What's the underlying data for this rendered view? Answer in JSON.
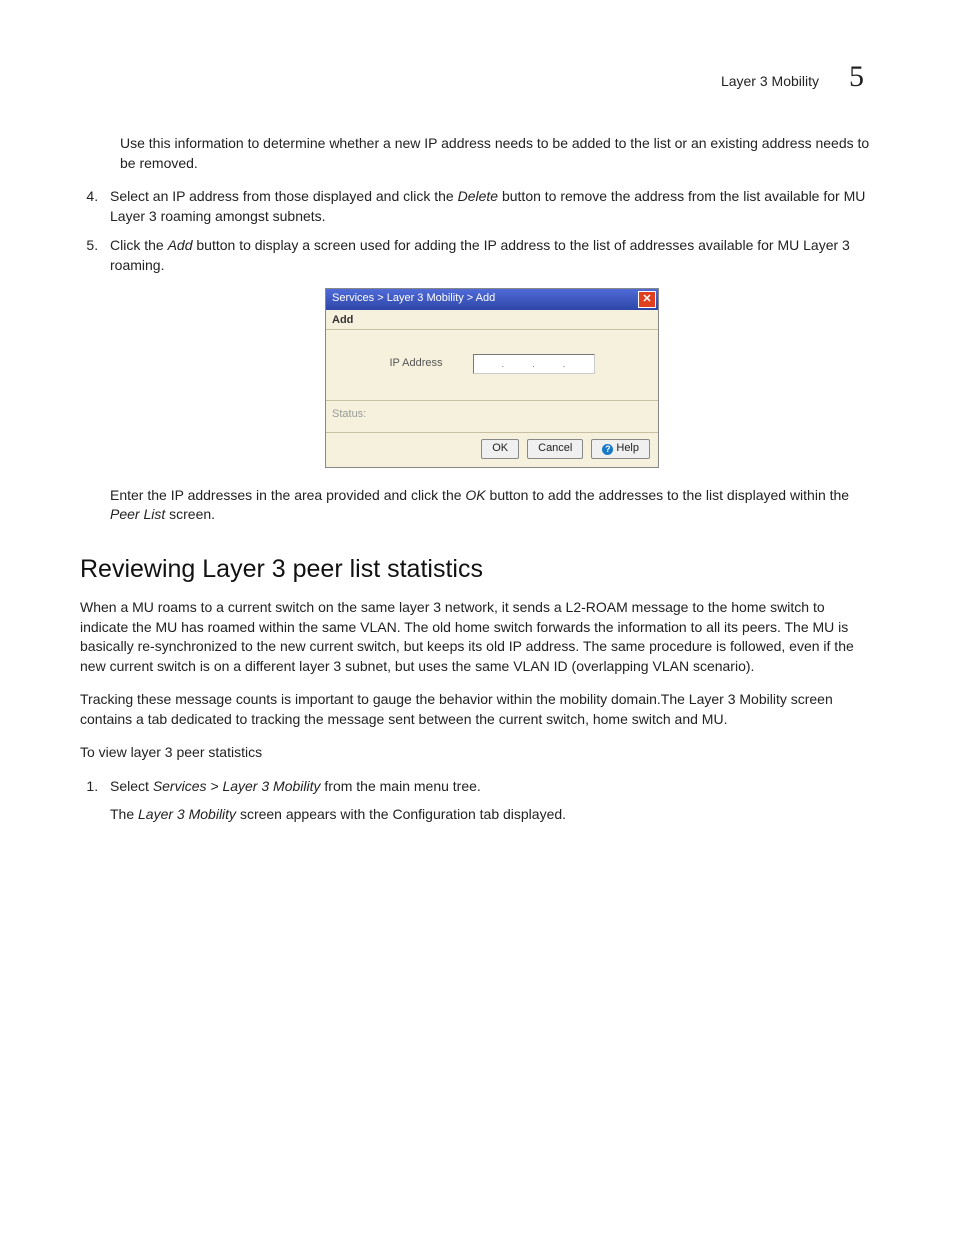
{
  "header": {
    "title": "Layer 3 Mobility",
    "chapter": "5"
  },
  "intro_para": "Use this information to determine whether a new IP address needs to be added to the list or an existing address needs to be removed.",
  "step4": {
    "pre": "Select an IP address from those displayed and click the ",
    "italic": "Delete",
    "post": " button to remove the address from the list available for MU Layer 3 roaming amongst subnets."
  },
  "step5": {
    "pre": "Click the ",
    "italic": "Add",
    "post": " button to display a screen used for adding the IP address to the list of addresses available for MU Layer 3 roaming."
  },
  "dialog": {
    "titlebar": "Services > Layer 3 Mobility > Add",
    "section_label": "Add",
    "ip_label": "IP Address",
    "status_label": "Status:",
    "ok": "OK",
    "cancel": "Cancel",
    "help": "Help"
  },
  "after_dialog": {
    "pre": "Enter the IP addresses in the area provided and click the ",
    "italic1": "OK",
    "mid": " button to add the addresses to the list displayed within the ",
    "italic2": "Peer List",
    "post": " screen."
  },
  "section_heading": "Reviewing Layer 3 peer list statistics",
  "para1": "When a MU roams to a current switch on the same layer 3 network, it sends a L2-ROAM message to the home switch to indicate the MU has roamed within the same VLAN. The old home switch forwards the information to all its peers. The MU is basically re-synchronized to the new current switch, but keeps its old IP address. The same procedure is followed, even if the new current switch is on a different layer 3 subnet, but uses the same VLAN ID (overlapping VLAN scenario).",
  "para2": "Tracking these message counts is important to gauge the behavior within the mobility domain.The Layer 3 Mobility screen contains a tab dedicated to tracking the message sent between the current switch, home switch and MU.",
  "para3": "To view layer 3 peer statistics",
  "step1": {
    "pre": "Select ",
    "italic": "Services > Layer 3 Mobility",
    "post": " from the main menu tree."
  },
  "sub1": {
    "pre": "The ",
    "italic": "Layer 3 Mobility",
    "post": " screen appears with the Configuration tab displayed."
  }
}
